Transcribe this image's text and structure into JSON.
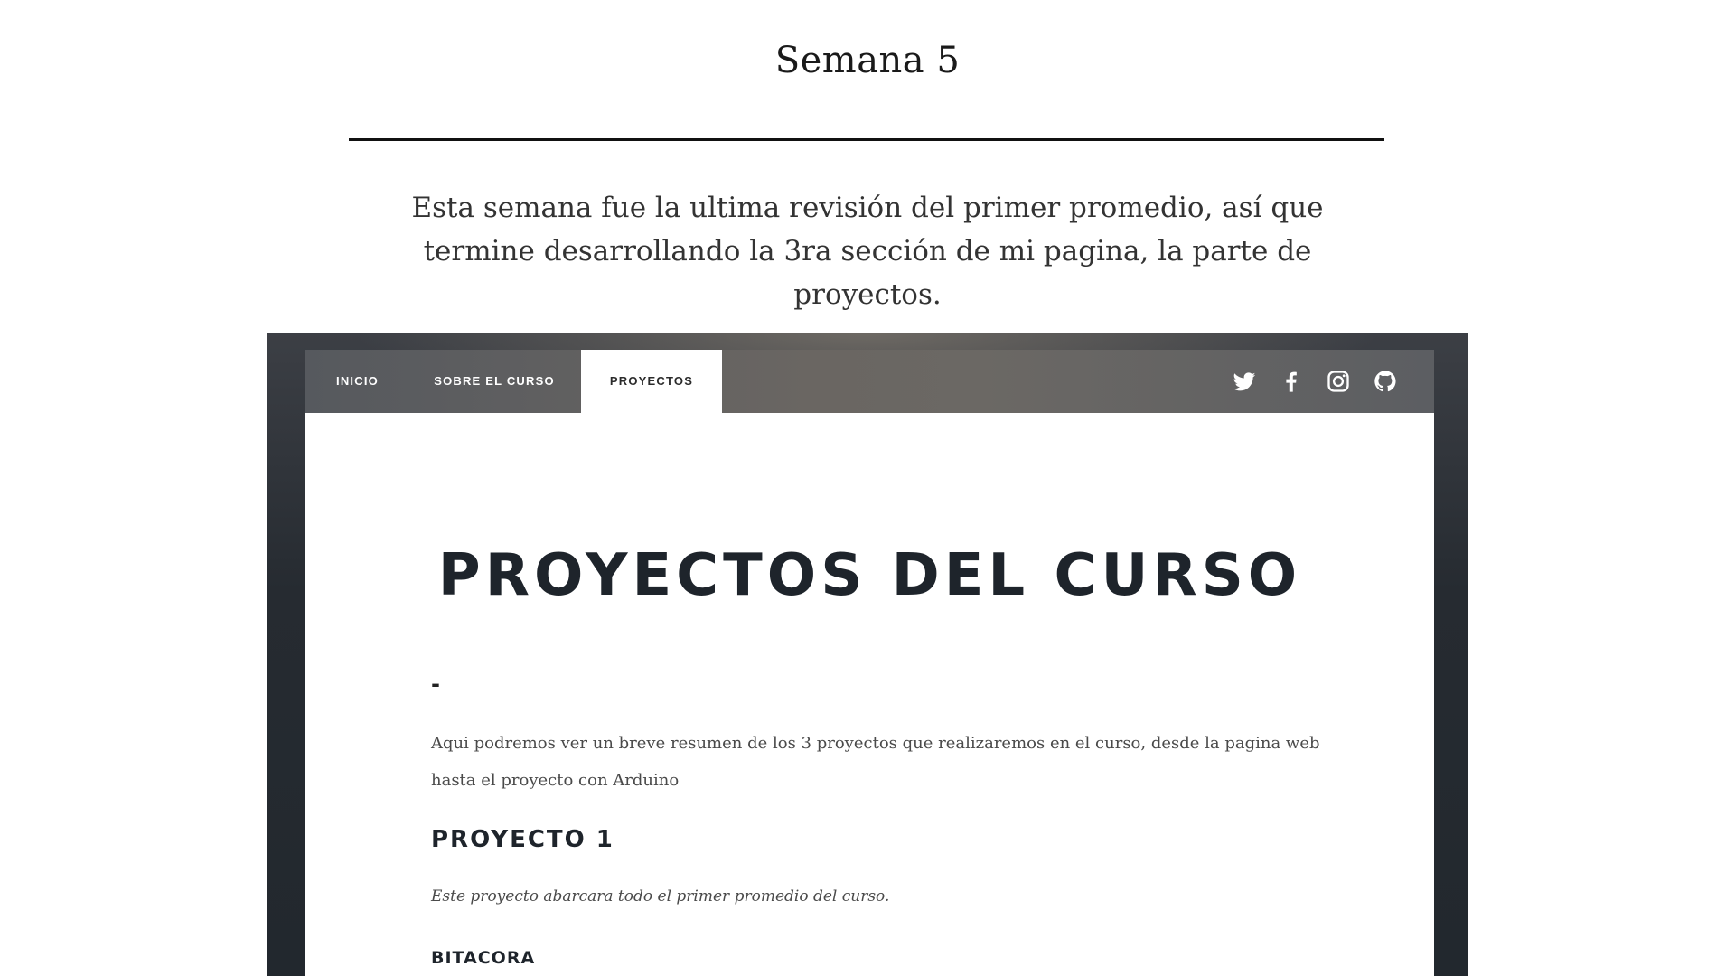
{
  "post": {
    "title": "Semana 5",
    "intro": "Esta semana fue la ultima revisión del primer promedio, así que termine desarrollando la 3ra sección de mi pagina, la parte de proyectos."
  },
  "screenshot": {
    "nav": {
      "items": [
        {
          "label": "INICIO",
          "active": false
        },
        {
          "label": "SOBRE EL CURSO",
          "active": false
        },
        {
          "label": "PROYECTOS",
          "active": true
        }
      ],
      "social_icons": [
        "twitter-icon",
        "facebook-icon",
        "instagram-icon",
        "github-icon"
      ]
    },
    "page": {
      "title": "PROYECTOS DEL CURSO",
      "dash": "-",
      "paragraph": "Aqui podremos ver un breve resumen de los 3 proyectos que realizaremos en el curso, desde la pagina web hasta el proyecto con Arduino",
      "section_title": "PROYECTO 1",
      "section_subtitle": "Este proyecto abarcara todo el primer promedio del curso.",
      "subsection_title": "BITACORA"
    },
    "colors": {
      "frame": "#262b31",
      "nav": "#5f6064",
      "heading": "#1e242b"
    }
  }
}
